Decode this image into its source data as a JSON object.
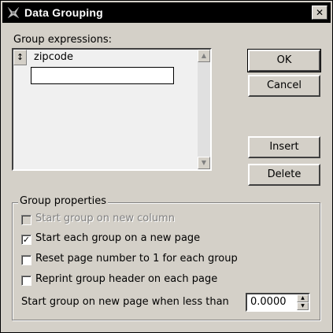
{
  "window": {
    "title": "Data Grouping",
    "close_label": "✕",
    "icon": "app-icon"
  },
  "group_expressions": {
    "label": "Group expressions:",
    "rows": [
      {
        "handle": "↕",
        "value": "zipcode"
      }
    ],
    "new_row_value": ""
  },
  "buttons": {
    "ok": "OK",
    "cancel": "Cancel",
    "insert": "Insert",
    "delete": "Delete"
  },
  "group_properties": {
    "title": "Group properties",
    "options": [
      {
        "label": "Start group on new column",
        "checked": false,
        "disabled": true
      },
      {
        "label": "Start each group on a new page",
        "checked": true,
        "disabled": false
      },
      {
        "label": "Reset page number to 1 for each group",
        "checked": false,
        "disabled": false
      },
      {
        "label": "Reprint group header on each page",
        "checked": false,
        "disabled": false
      }
    ],
    "threshold_label": "Start group on new page when less than",
    "threshold_value": "0.0000"
  }
}
